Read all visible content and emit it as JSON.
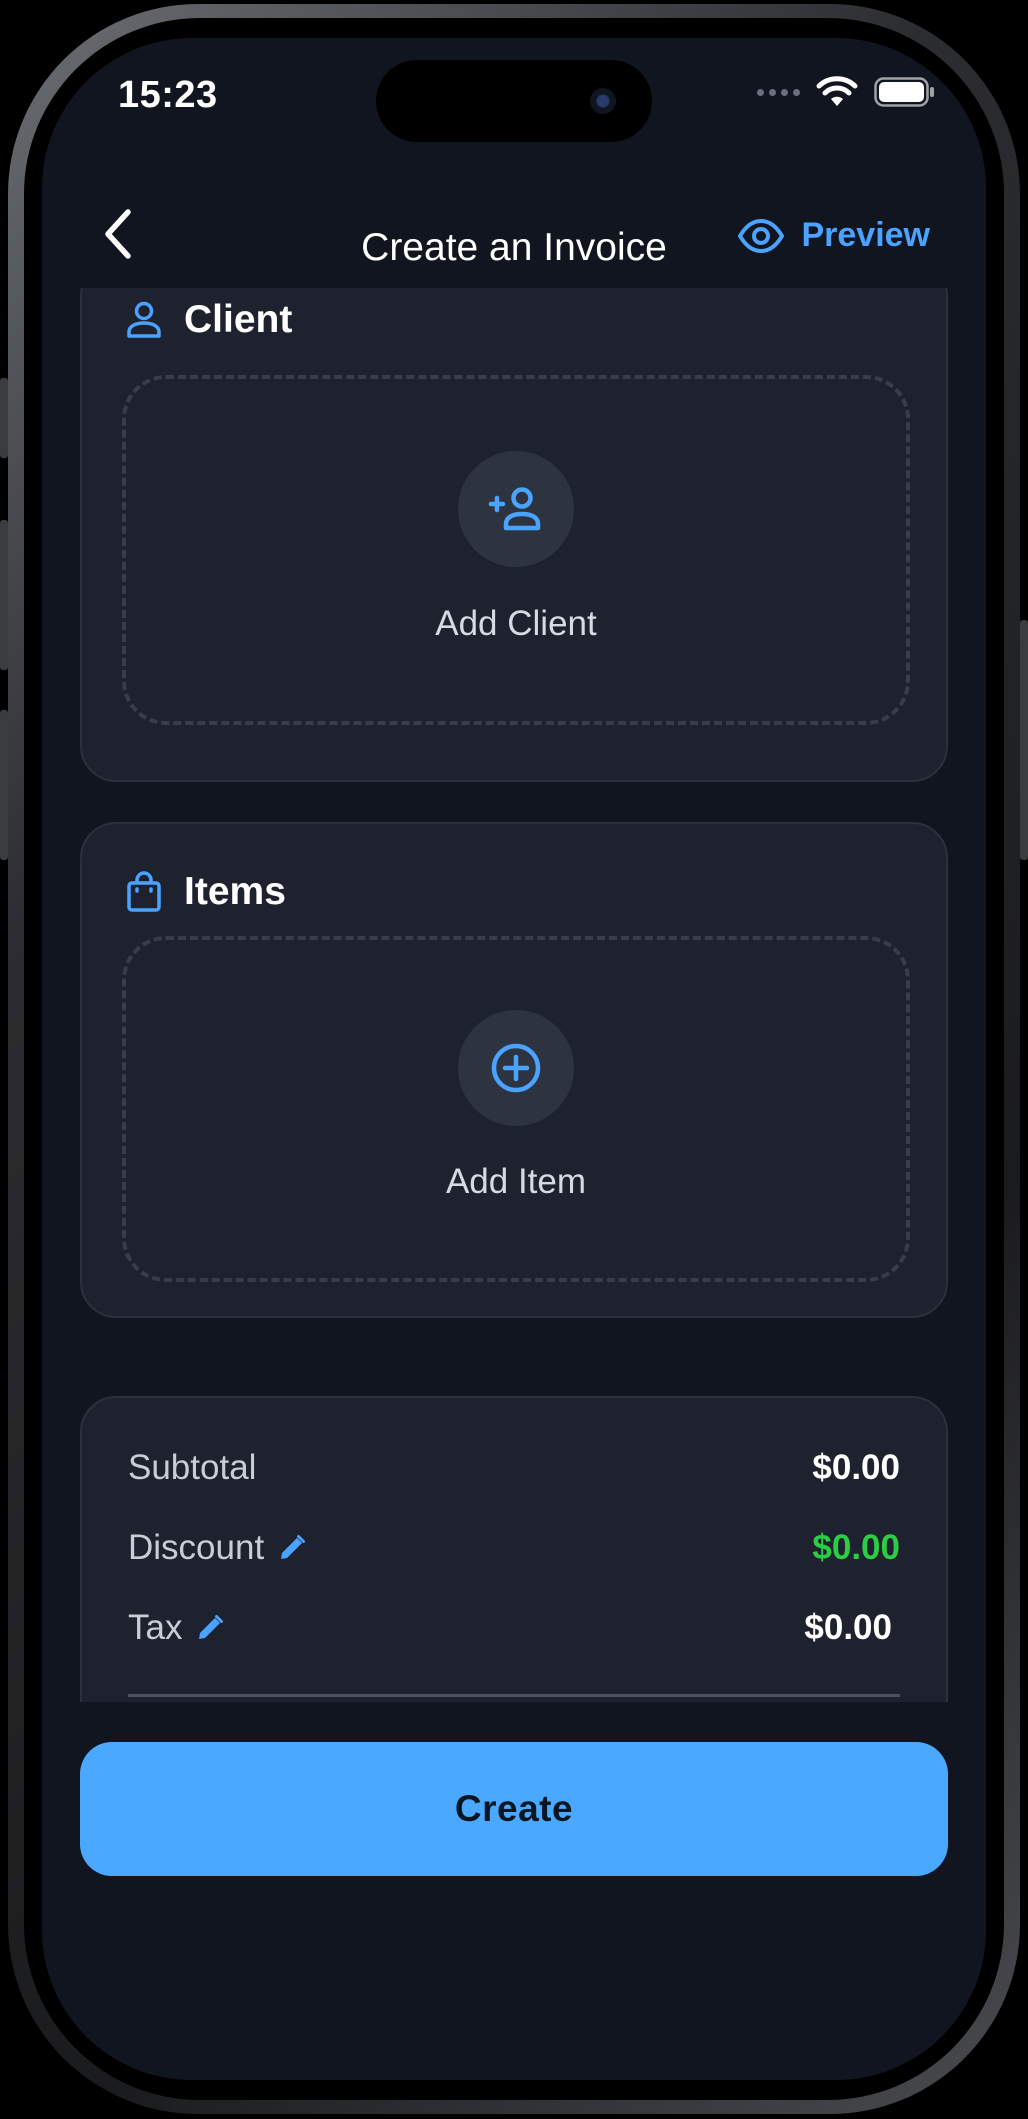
{
  "status": {
    "time": "15:23"
  },
  "nav": {
    "title": "Create an Invoice",
    "preview_label": "Preview"
  },
  "client": {
    "title": "Client",
    "add_label": "Add Client"
  },
  "items": {
    "title": "Items",
    "add_label": "Add Item"
  },
  "summary": {
    "subtotal_label": "Subtotal",
    "subtotal_value": "$0.00",
    "discount_label": "Discount",
    "discount_value": "$0.00",
    "tax_label": "Tax",
    "tax_value": "$0.00"
  },
  "actions": {
    "create_label": "Create"
  },
  "colors": {
    "accent": "#4aa3ff",
    "discount": "#2ccd45",
    "background": "#10151f",
    "card": "#1d222e"
  },
  "icons": [
    "back-chevron-icon",
    "eye-icon",
    "person-icon",
    "person-add-icon",
    "shopping-bag-icon",
    "plus-circle-icon",
    "pencil-icon",
    "wifi-icon",
    "battery-icon"
  ]
}
